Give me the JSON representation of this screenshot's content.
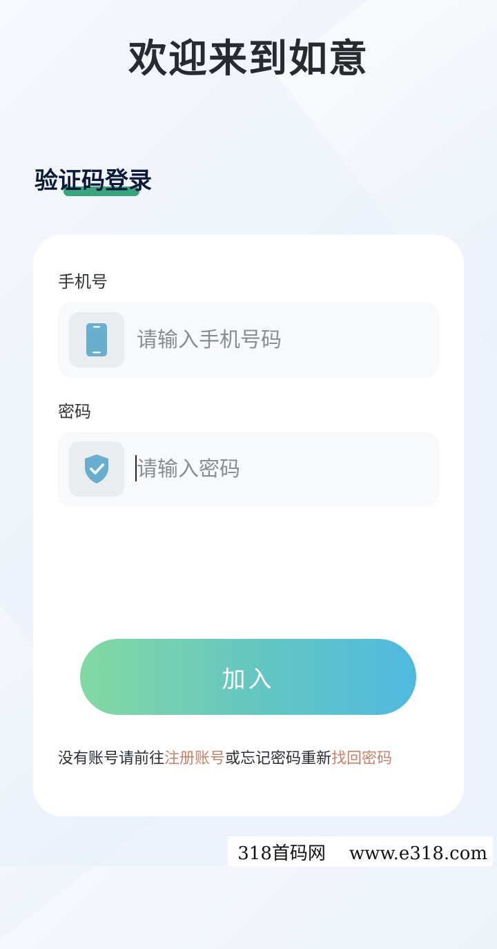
{
  "header": {
    "title": "欢迎来到如意"
  },
  "login": {
    "heading": "验证码登录"
  },
  "form": {
    "phone": {
      "label": "手机号",
      "placeholder": "请输入手机号码",
      "icon": "phone-icon"
    },
    "password": {
      "label": "密码",
      "placeholder": "请输入密码",
      "icon": "shield-check-icon"
    },
    "submit_label": "加入"
  },
  "footer": {
    "text_1": "没有账号请前往",
    "register_link": "注册账号",
    "text_2": "或忘记密码重新",
    "recover_link": "找回密码"
  },
  "watermark": {
    "left": "318首码网",
    "right": "www.e318.com"
  },
  "colors": {
    "accent_green": "#3aa57d",
    "link": "#c78269",
    "button_start": "#84d9a2",
    "button_end": "#50b9e0",
    "icon_blue": "#6aaecd"
  }
}
